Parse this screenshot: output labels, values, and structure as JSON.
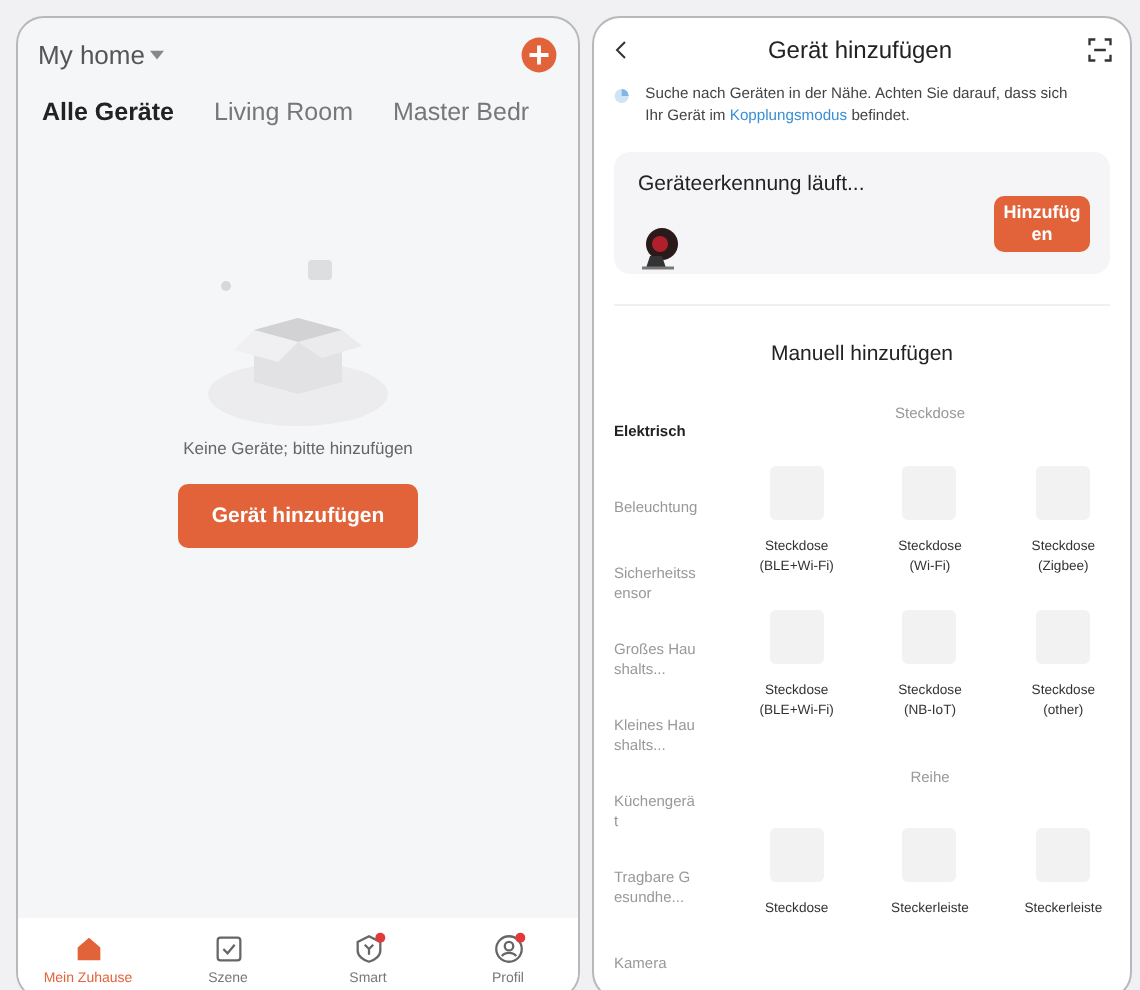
{
  "home": {
    "title": "My home",
    "tabs": [
      {
        "label": "Alle Geräte",
        "selected": true
      },
      {
        "label": "Living Room",
        "selected": false
      },
      {
        "label": "Master Bedr",
        "selected": false
      }
    ],
    "empty_text": "Keine Geräte; bitte hinzufügen",
    "add_button": "Gerät hinzufügen",
    "nav": [
      {
        "label": "Mein Zuhause",
        "kind": "home",
        "selected": true,
        "badge": false
      },
      {
        "label": "Szene",
        "kind": "scene",
        "selected": false,
        "badge": false
      },
      {
        "label": "Smart",
        "kind": "smart",
        "selected": false,
        "badge": true
      },
      {
        "label": "Profil",
        "kind": "profile",
        "selected": false,
        "badge": true
      }
    ]
  },
  "add_device": {
    "title": "Gerät hinzufügen",
    "info": {
      "before": "Suche nach Geräten in der Nähe. Achten Sie darauf, dass sich Ihr Gerät im",
      "link": "Kopplungsmodus",
      "after": "befindet."
    },
    "discovery": {
      "title": "Geräteerkennung läuft...",
      "button": "Hinzufügen"
    },
    "manual_title": "Manuell hinzufügen",
    "categories": [
      {
        "label": "Elektrisch",
        "selected": true
      },
      {
        "label": "Beleuchtung",
        "selected": false
      },
      {
        "label": "Sicherheitssensor",
        "selected": false
      },
      {
        "label": "Großes Haushalts...",
        "selected": false
      },
      {
        "label": "Kleines Haushalts...",
        "selected": false
      },
      {
        "label": "Küchengerät",
        "selected": false
      },
      {
        "label": "Tragbare Gesundhe...",
        "selected": false
      },
      {
        "label": "Kamera",
        "selected": false
      }
    ],
    "sections": [
      {
        "title": "Steckdose",
        "devices": [
          {
            "name": "Steckdose",
            "variant": "(BLE+Wi-Fi)"
          },
          {
            "name": "Steckdose",
            "variant": "(Wi-Fi)"
          },
          {
            "name": "Steckdose",
            "variant": "(Zigbee)"
          },
          {
            "name": "Steckdose",
            "variant": "(BLE+Wi-Fi)"
          },
          {
            "name": "Steckdose",
            "variant": "(NB-IoT)"
          },
          {
            "name": "Steckdose",
            "variant": "(other)"
          }
        ]
      },
      {
        "title": "Reihe",
        "devices": [
          {
            "name": "Steckdose"
          },
          {
            "name": "Steckerleiste"
          },
          {
            "name": "Steckerleiste"
          }
        ]
      }
    ]
  }
}
